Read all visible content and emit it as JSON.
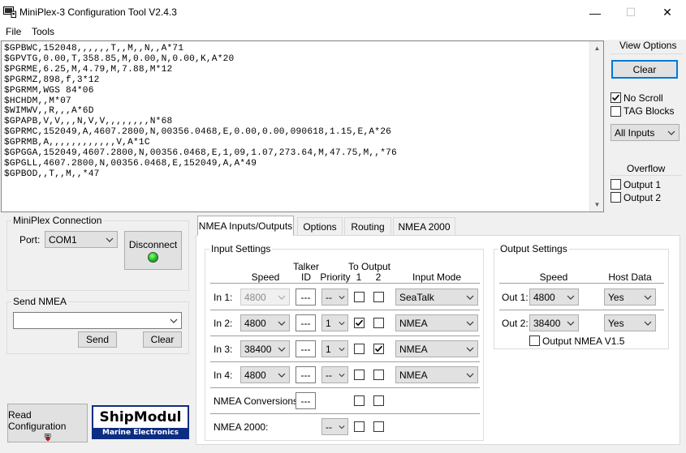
{
  "window": {
    "title": "MiniPlex-3 Configuration Tool V2.4.3",
    "minimize": "—",
    "maximize": "☐",
    "close": "✕"
  },
  "menu": {
    "file": "File",
    "tools": "Tools"
  },
  "log_lines": [
    "$GPBWC,152048,,,,,,T,,M,,N,,A*71",
    "$GPVTG,0.00,T,358.85,M,0.00,N,0.00,K,A*20",
    "$PGRME,6.25,M,4.79,M,7.88,M*12",
    "$PGRMZ,898,f,3*12",
    "$PGRMM,WGS 84*06",
    "$HCHDM,,M*07",
    "$WIMWV,,R,,,A*6D",
    "$GPAPB,V,V,,,N,V,V,,,,,,,,N*68",
    "$GPRMC,152049,A,4607.2800,N,00356.0468,E,0.00,0.00,090618,1.15,E,A*26",
    "$GPRMB,A,,,,,,,,,,,,V,A*1C",
    "$GPGGA,152049,4607.2800,N,00356.0468,E,1,09,1.07,273.64,M,47.75,M,,*76",
    "$GPGLL,4607.2800,N,00356.0468,E,152049,A,A*49",
    "$GPBOD,,T,,M,,*47"
  ],
  "view_options": {
    "title": "View Options",
    "clear": "Clear",
    "no_scroll": "No Scroll",
    "no_scroll_checked": true,
    "tag_blocks": "TAG Blocks",
    "tag_blocks_checked": false,
    "filter": "All Inputs"
  },
  "overflow": {
    "title": "Overflow",
    "output1": "Output 1",
    "output2": "Output 2"
  },
  "connection": {
    "title": "MiniPlex Connection",
    "port_label": "Port:",
    "port_value": "COM1",
    "disconnect": "Disconnect"
  },
  "send_nmea": {
    "title": "Send NMEA",
    "value": "",
    "send": "Send",
    "clear": "Clear"
  },
  "read_config": "Read Configuration",
  "logo": {
    "name": "ShipModul",
    "sub": "Marine Electronics"
  },
  "tabs": [
    "NMEA Inputs/Outputs",
    "Options",
    "Routing",
    "NMEA 2000"
  ],
  "input_settings": {
    "title": "Input Settings",
    "headers": {
      "speed": "Speed",
      "talker1": "Talker",
      "talker2": "ID",
      "priority": "Priority",
      "to_output": "To Output",
      "out1": "1",
      "out2": "2",
      "input_mode": "Input Mode"
    },
    "rows": [
      {
        "label": "In 1:",
        "speed": "4800",
        "talker": "---",
        "priority": "--",
        "o1": false,
        "o2": false,
        "mode": "SeaTalk"
      },
      {
        "label": "In 2:",
        "speed": "4800",
        "talker": "---",
        "priority": "1",
        "o1": true,
        "o2": false,
        "mode": "NMEA"
      },
      {
        "label": "In 3:",
        "speed": "38400",
        "talker": "---",
        "priority": "1",
        "o1": false,
        "o2": true,
        "mode": "NMEA"
      },
      {
        "label": "In 4:",
        "speed": "4800",
        "talker": "---",
        "priority": "--",
        "o1": false,
        "o2": false,
        "mode": "NMEA"
      }
    ],
    "conversions_label": "NMEA Conversions:",
    "conversions_talker": "---",
    "n2k_label": "NMEA 2000:",
    "n2k_priority": "--"
  },
  "output_settings": {
    "title": "Output Settings",
    "headers": {
      "speed": "Speed",
      "host": "Host Data"
    },
    "rows": [
      {
        "label": "Out 1:",
        "speed": "4800",
        "host": "Yes"
      },
      {
        "label": "Out 2:",
        "speed": "38400",
        "host": "Yes"
      }
    ],
    "v15": "Output NMEA V1.5"
  }
}
